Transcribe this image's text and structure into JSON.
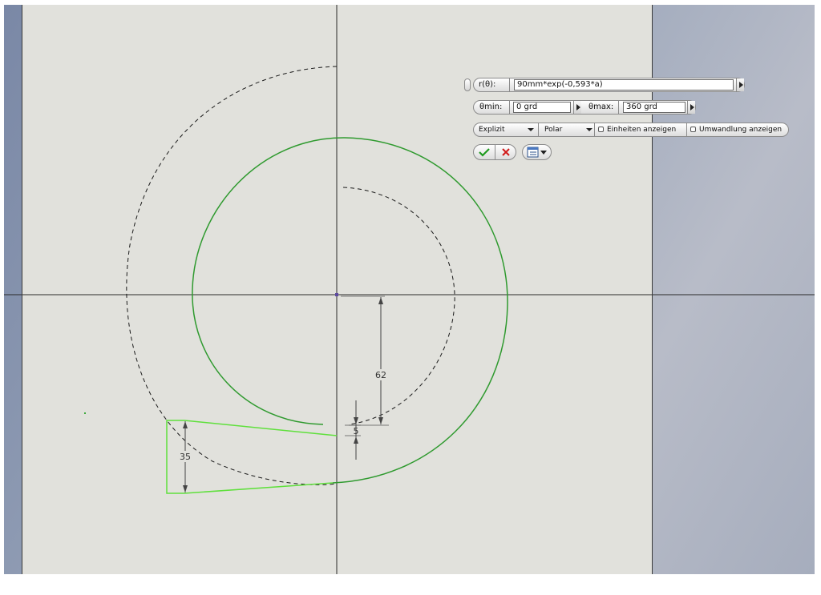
{
  "formula": {
    "func_label": "r(θ):",
    "expression": "90mm*exp(-0,593*a)"
  },
  "range": {
    "min_label": "θmin:",
    "min_value": "0 grd",
    "max_label": "θmax:",
    "max_value": "360 grd"
  },
  "options": {
    "mode_value": "Explizit",
    "coord_value": "Polar",
    "show_units_label": "Einheiten anzeigen",
    "show_conversion_label": "Umwandlung anzeigen"
  },
  "dimensions": {
    "d62": "62",
    "d5": "5",
    "d35": "35"
  },
  "colors": {
    "sketch_green": "#2f9a2f",
    "profile_green": "#5fe03c",
    "sheet": "#e1e1dc",
    "accept_green": "#1e9a1e",
    "cancel_red": "#d11a1a"
  },
  "icons": {
    "accept": "checkmark-icon",
    "cancel": "close-icon",
    "options": "list-options-icon"
  }
}
